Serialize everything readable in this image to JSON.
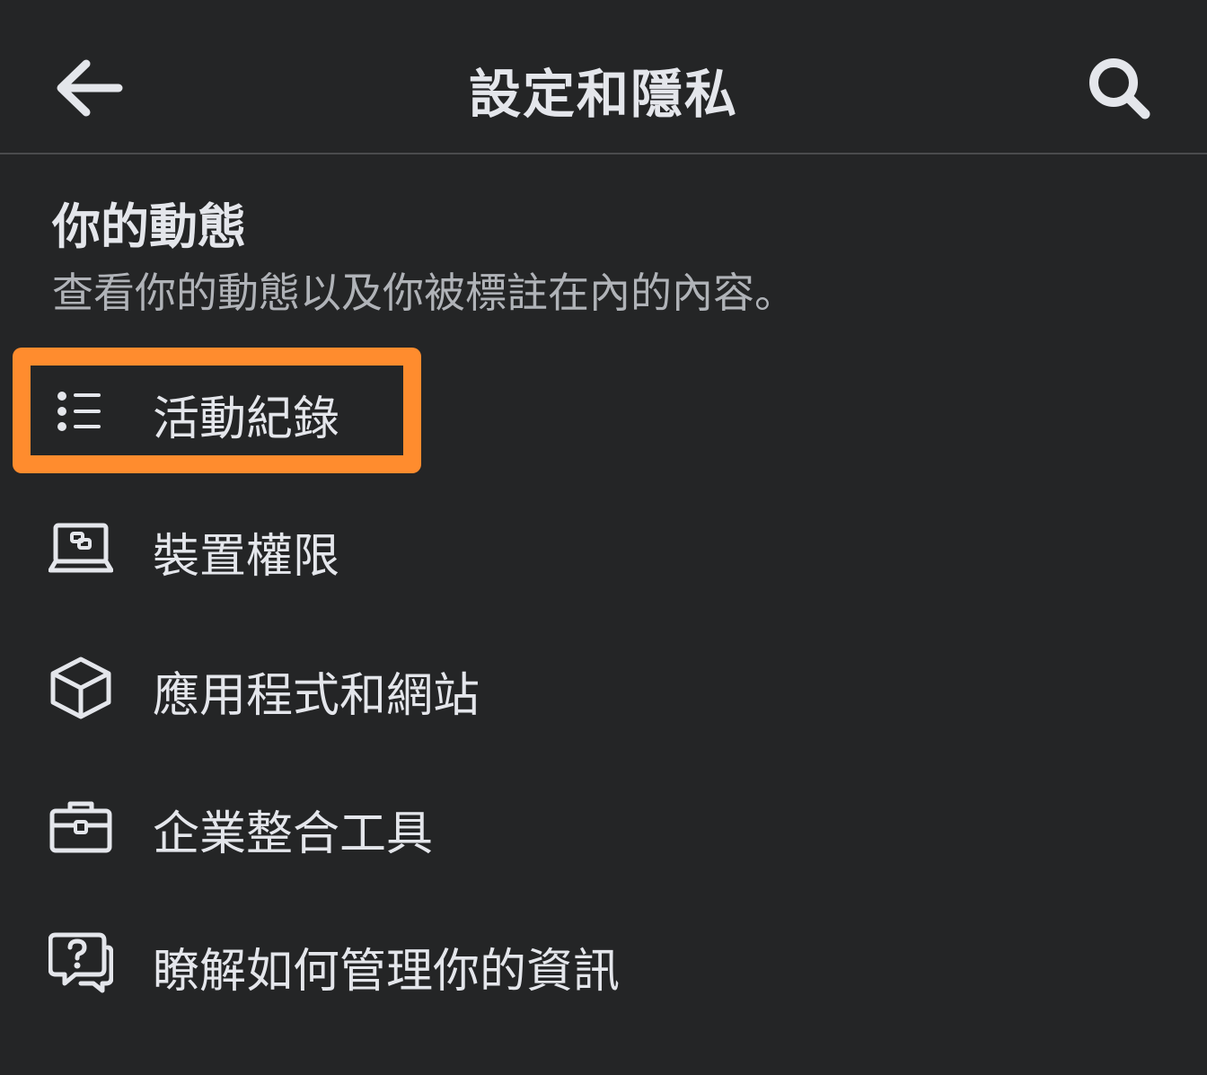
{
  "header": {
    "title": "設定和隱私",
    "back_icon": "arrow-left-icon",
    "search_icon": "search-icon"
  },
  "section": {
    "title": "你的動態",
    "subtitle": "查看你的動態以及你被標註在內的內容。"
  },
  "menu": {
    "items": [
      {
        "label": "活動紀錄",
        "icon": "list-icon",
        "highlighted": true
      },
      {
        "label": "裝置權限",
        "icon": "laptop-icon"
      },
      {
        "label": "應用程式和網站",
        "icon": "cube-icon"
      },
      {
        "label": "企業整合工具",
        "icon": "briefcase-icon"
      },
      {
        "label": "瞭解如何管理你的資訊",
        "icon": "question-chat-icon"
      }
    ]
  },
  "colors": {
    "background": "#242526",
    "text": "#e4e6eb",
    "subtext": "#b0b3b8",
    "divider": "#4a4b4d",
    "highlight": "#ff8c2e"
  }
}
